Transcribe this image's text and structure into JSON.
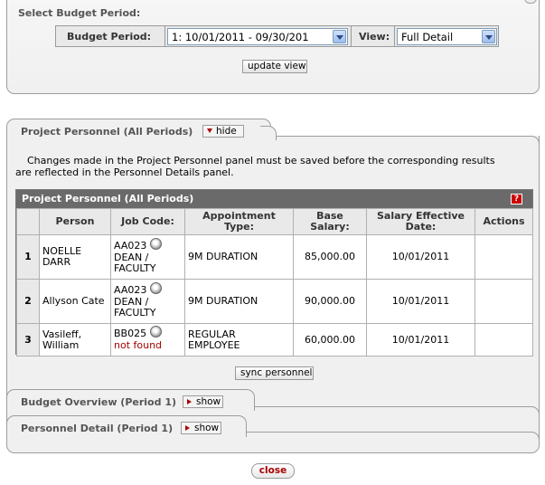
{
  "period_panel": {
    "title": "Select Budget Period:",
    "budget_period_label": "Budget Period:",
    "budget_period_value": "1: 10/01/2011 - 09/30/201",
    "view_label": "View:",
    "view_value": "Full Detail",
    "update_view_label": "update view"
  },
  "project_personnel": {
    "tab_title": "Project Personnel (All Periods)",
    "hide_label": "hide",
    "notice_line1": "Changes made in the Project Personnel panel must be saved before the corresponding results",
    "notice_line2": "are reflected in the Personnel Details panel.",
    "table_title": "Project Personnel (All Periods)",
    "help_icon": "help-icon",
    "columns": [
      "Person",
      "Job Code:",
      "Appointment Type:",
      "Base Salary:",
      "Salary Effective Date:",
      "Actions"
    ],
    "rows": [
      {
        "num": "1",
        "person": "NOELLE DARR",
        "job_code": "AA023",
        "job_desc": "DEAN / FACULTY",
        "appointment": "9M DURATION",
        "salary": "85,000.00",
        "date": "10/01/2011",
        "actions": ""
      },
      {
        "num": "2",
        "person": "Allyson Cate",
        "job_code": "AA023",
        "job_desc": "DEAN / FACULTY",
        "appointment": "9M DURATION",
        "salary": "90,000.00",
        "date": "10/01/2011",
        "actions": ""
      },
      {
        "num": "3",
        "person": "Vasileff, William",
        "job_code": "BB025",
        "job_desc": "not found",
        "appointment": "REGULAR EMPLOYEE",
        "salary": "60,000.00",
        "date": "10/01/2011",
        "actions": ""
      }
    ],
    "sync_label": "sync personnel"
  },
  "budget_overview": {
    "title": "Budget Overview (Period 1)",
    "show_label": "show"
  },
  "personnel_detail": {
    "title": "Personnel Detail (Period 1)",
    "show_label": "show"
  },
  "close_label": "close",
  "colors": {
    "accent_red": "#aa0000",
    "header_gray": "#6a6a6a",
    "panel_bg": "#f0f0f0"
  }
}
